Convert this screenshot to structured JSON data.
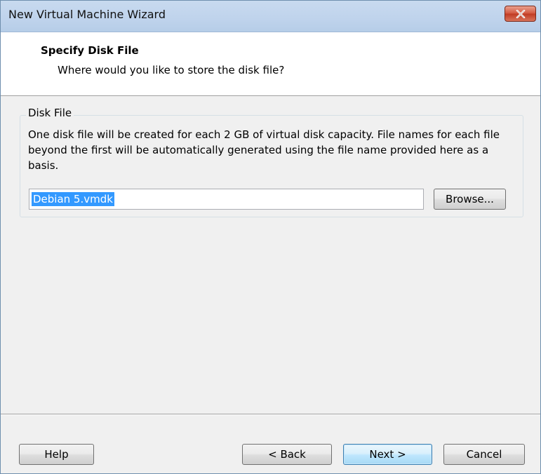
{
  "window": {
    "title": "New Virtual Machine Wizard",
    "close_icon": "close-x-icon"
  },
  "header": {
    "title": "Specify Disk File",
    "subtitle": "Where would you like to store the disk file?"
  },
  "disk_file_group": {
    "legend": "Disk File",
    "description": "One disk file will be created for each 2 GB of virtual disk capacity. File names for each file beyond the first will be automatically generated using the file name provided here as a basis.",
    "filename_value": "Debian 5.vmdk",
    "browse_label": "Browse..."
  },
  "footer": {
    "help_label": "Help",
    "back_label": "< Back",
    "next_label": "Next >",
    "cancel_label": "Cancel"
  },
  "colors": {
    "titlebar": "#bfd3ec",
    "close_button": "#c7432b",
    "selection": "#3399ff",
    "dialog_background": "#f0f0f0"
  }
}
